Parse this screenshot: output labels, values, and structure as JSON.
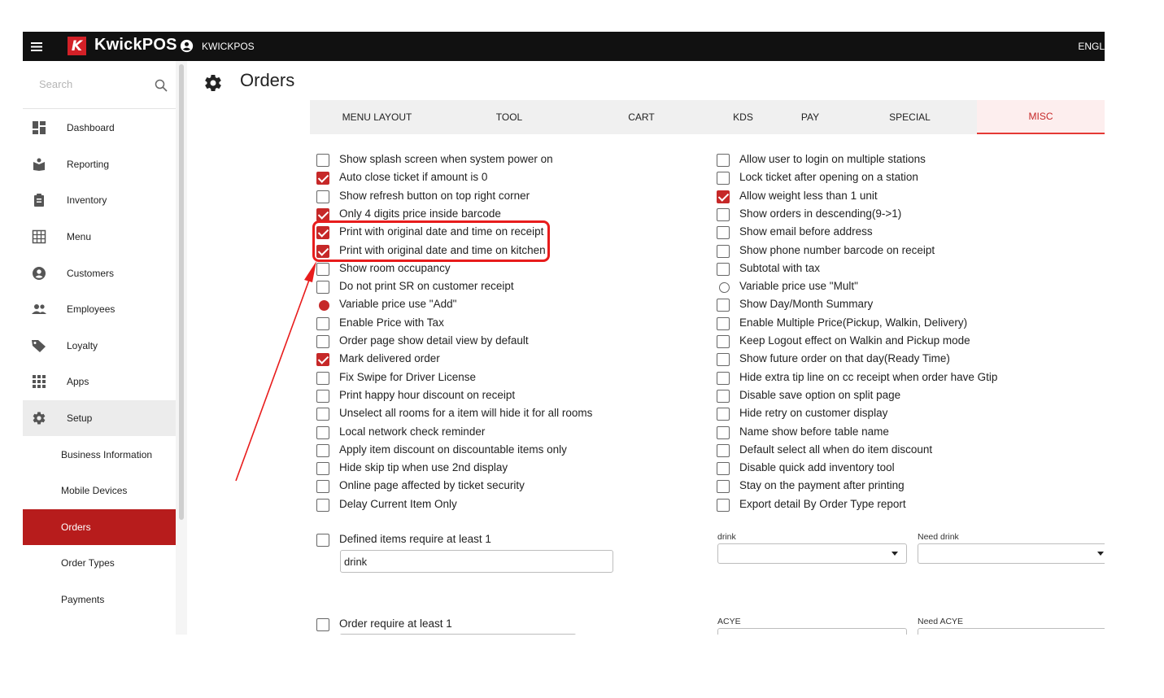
{
  "topbar": {
    "brand_letter": "K",
    "brand": "KwickPOS",
    "user": "KWICKPOS",
    "language": "ENGL"
  },
  "sidebar": {
    "search_placeholder": "Search",
    "items": [
      {
        "label": "Dashboard",
        "icon": "dashboard-icon"
      },
      {
        "label": "Reporting",
        "icon": "reporting-icon"
      },
      {
        "label": "Inventory",
        "icon": "inventory-icon"
      },
      {
        "label": "Menu",
        "icon": "menu-grid-icon"
      },
      {
        "label": "Customers",
        "icon": "customers-icon"
      },
      {
        "label": "Employees",
        "icon": "employees-icon"
      },
      {
        "label": "Loyalty",
        "icon": "loyalty-tag-icon"
      },
      {
        "label": "Apps",
        "icon": "apps-icon"
      },
      {
        "label": "Setup",
        "icon": "setup-gear-icon"
      }
    ],
    "sub_items": [
      {
        "label": "Business Information"
      },
      {
        "label": "Mobile Devices"
      },
      {
        "label": "Orders",
        "active": true
      },
      {
        "label": "Order Types"
      },
      {
        "label": "Payments"
      }
    ]
  },
  "page": {
    "title": "Orders"
  },
  "tabs": [
    "MENU LAYOUT",
    "TOOL",
    "CART",
    "KDS",
    "PAY",
    "SPECIAL",
    "MISC"
  ],
  "active_tab": "MISC",
  "left_options": [
    {
      "label": "Show splash screen when system power on",
      "checked": false,
      "kind": "checkbox"
    },
    {
      "label": "Auto close ticket if amount is 0",
      "checked": true,
      "kind": "checkbox"
    },
    {
      "label": "Show refresh button on top right corner",
      "checked": false,
      "kind": "checkbox"
    },
    {
      "label": "Only 4 digits price inside barcode",
      "checked": true,
      "kind": "checkbox"
    },
    {
      "label": "Print with original date and time on receipt",
      "checked": true,
      "kind": "checkbox"
    },
    {
      "label": "Print with original date and time on kitchen",
      "checked": true,
      "kind": "checkbox"
    },
    {
      "label": "Show room occupancy",
      "checked": false,
      "kind": "checkbox"
    },
    {
      "label": "Do not print SR on customer receipt",
      "checked": false,
      "kind": "checkbox"
    },
    {
      "label": "Variable price use \"Add\"",
      "checked": true,
      "kind": "radio"
    },
    {
      "label": "Enable Price with Tax",
      "checked": false,
      "kind": "checkbox"
    },
    {
      "label": "Order page show detail view by default",
      "checked": false,
      "kind": "checkbox"
    },
    {
      "label": "Mark delivered order",
      "checked": true,
      "kind": "checkbox"
    },
    {
      "label": "Fix Swipe for Driver License",
      "checked": false,
      "kind": "checkbox"
    },
    {
      "label": "Print happy hour discount on receipt",
      "checked": false,
      "kind": "checkbox"
    },
    {
      "label": "Unselect all rooms for a item will hide it for all rooms",
      "checked": false,
      "kind": "checkbox"
    },
    {
      "label": "Local network check reminder",
      "checked": false,
      "kind": "checkbox"
    },
    {
      "label": "Apply item discount on discountable items only",
      "checked": false,
      "kind": "checkbox"
    },
    {
      "label": "Hide skip tip when use 2nd display",
      "checked": false,
      "kind": "checkbox"
    },
    {
      "label": "Online page affected by ticket security",
      "checked": false,
      "kind": "checkbox"
    },
    {
      "label": "Delay Current Item Only",
      "checked": false,
      "kind": "checkbox"
    }
  ],
  "right_options": [
    {
      "label": "Allow user to login on multiple stations",
      "checked": false,
      "kind": "checkbox"
    },
    {
      "label": "Lock ticket after opening on a station",
      "checked": false,
      "kind": "checkbox"
    },
    {
      "label": "Allow weight less than 1 unit",
      "checked": true,
      "kind": "checkbox"
    },
    {
      "label": "Show orders in descending(9->1)",
      "checked": false,
      "kind": "checkbox"
    },
    {
      "label": "Show email before address",
      "checked": false,
      "kind": "checkbox"
    },
    {
      "label": "Show phone number barcode on receipt",
      "checked": false,
      "kind": "checkbox"
    },
    {
      "label": "Subtotal with tax",
      "checked": false,
      "kind": "checkbox"
    },
    {
      "label": "Variable price use \"Mult\"",
      "checked": false,
      "kind": "radio"
    },
    {
      "label": "Show Day/Month Summary",
      "checked": false,
      "kind": "checkbox"
    },
    {
      "label": "Enable Multiple Price(Pickup, Walkin, Delivery)",
      "checked": false,
      "kind": "checkbox"
    },
    {
      "label": "Keep Logout effect on Walkin and Pickup mode",
      "checked": false,
      "kind": "checkbox"
    },
    {
      "label": "Show future order on that day(Ready Time)",
      "checked": false,
      "kind": "checkbox"
    },
    {
      "label": "Hide extra tip line on cc receipt when order have Gtip",
      "checked": false,
      "kind": "checkbox"
    },
    {
      "label": "Disable save option on split page",
      "checked": false,
      "kind": "checkbox"
    },
    {
      "label": "Hide retry on customer display",
      "checked": false,
      "kind": "checkbox"
    },
    {
      "label": "Name show before table name",
      "checked": false,
      "kind": "checkbox"
    },
    {
      "label": "Default select all when do item discount",
      "checked": false,
      "kind": "checkbox"
    },
    {
      "label": "Disable quick add inventory tool",
      "checked": false,
      "kind": "checkbox"
    },
    {
      "label": "Stay on the payment after printing",
      "checked": false,
      "kind": "checkbox"
    },
    {
      "label": "Export detail By Order Type report",
      "checked": false,
      "kind": "checkbox"
    }
  ],
  "defined_items": {
    "label": "Defined items require at least 1",
    "checked": false,
    "value": "drink"
  },
  "drink_select": {
    "label": "drink",
    "value": ""
  },
  "need_drink_select": {
    "label": "Need drink",
    "value": ""
  },
  "order_require": {
    "label": "Order require at least 1",
    "checked": false
  },
  "acye_select": {
    "label": "ACYE"
  },
  "need_acye_select": {
    "label": "Need ACYE"
  },
  "colors": {
    "accent": "#c62828",
    "topbar": "#111111",
    "highlight": "#e81c1c"
  }
}
